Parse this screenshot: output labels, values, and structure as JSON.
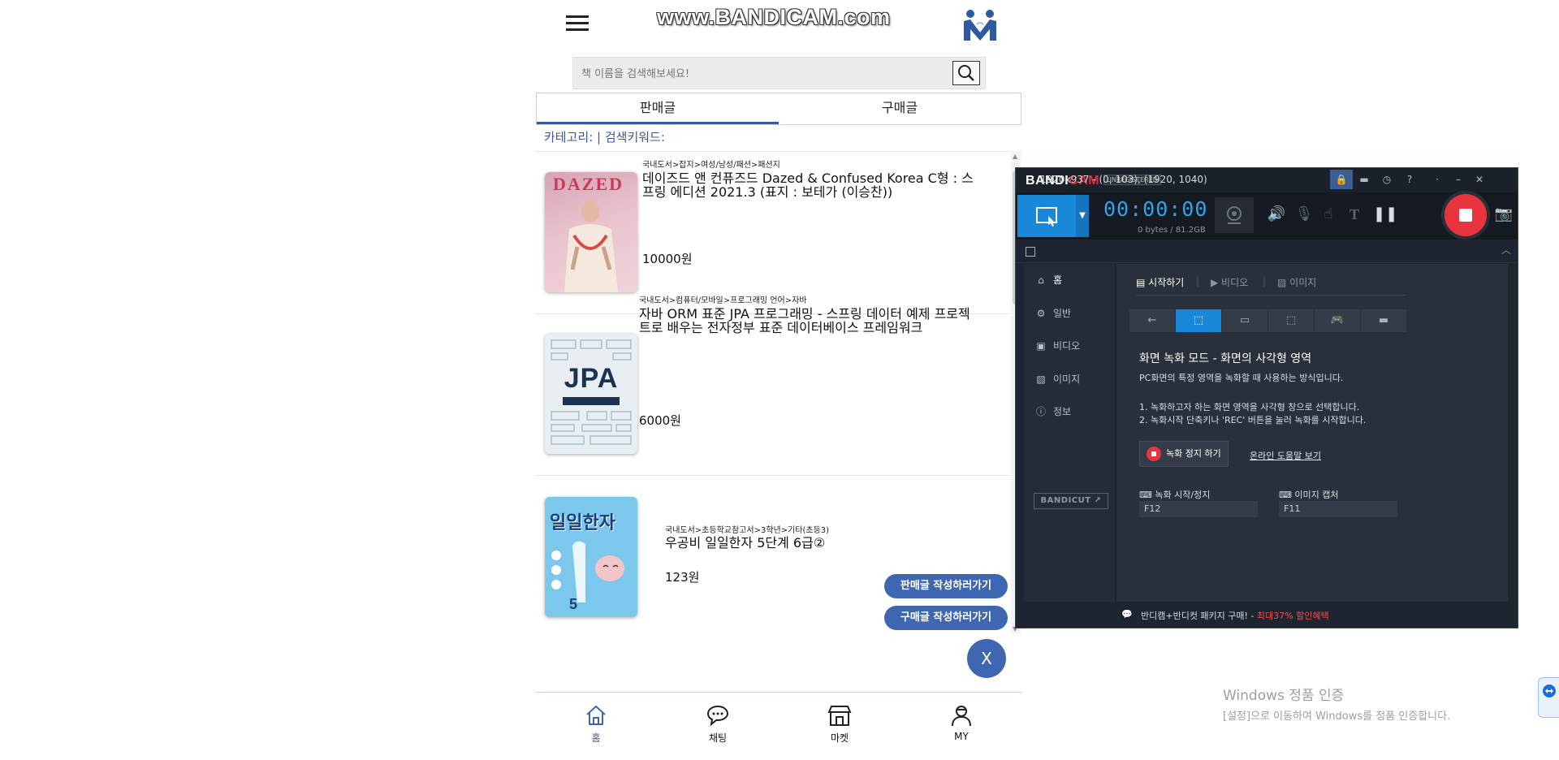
{
  "app": {
    "watermark": "www.BANDICAM.com",
    "search": {
      "placeholder": "책 이름을 검색해보세요!"
    },
    "tabs": [
      {
        "label": "판매글"
      },
      {
        "label": "구매글"
      }
    ],
    "category_line": "카테고리: | 검색키워드:",
    "books": [
      {
        "category_path": "국내도서>잡지>여성/남성/패션>패션지",
        "title": "데이즈드 앤 컨퓨즈드 Dazed & Confused Korea C형 : 스프링 에디션 2021.3 (표지 : 보테가 (이승찬))",
        "price": "10000원",
        "cover_text": "DAZED"
      },
      {
        "category_path": "국내도서>컴퓨터/모바일>프로그래밍 언어>자바",
        "title": "자바 ORM 표준 JPA 프로그래밍 - 스프링 데이터 예제 프로젝트로 배우는 전자정부 표준 데이터베이스 프레임워크",
        "price": "6000원",
        "cover_text": "JPA"
      },
      {
        "category_path": "국내도서>초등학교참고서>3학년>기타(초등3)",
        "title": "우공비 일일한자 5단계 6급②",
        "price": "123원",
        "cover_text": "일일한자"
      }
    ],
    "fab_buttons": [
      {
        "label": "판매글 작성하러가기"
      },
      {
        "label": "구매글 작성하러가기"
      }
    ],
    "close_label": "X",
    "bottom_nav": [
      {
        "label": "홈"
      },
      {
        "label": "채팅"
      },
      {
        "label": "마켓"
      },
      {
        "label": "MY"
      }
    ]
  },
  "bandicam": {
    "brand_main": "BANDI",
    "brand_accent": "CAM",
    "unregistered": "UNREGISTERED",
    "timer": "00:00:00",
    "bytes": "0 bytes / 81.2GB",
    "area": "1920x937 - (0, 103), (1920, 1040)",
    "sidebar": [
      {
        "label": "홈",
        "icon": "home-icon"
      },
      {
        "label": "일반",
        "icon": "gear-icon"
      },
      {
        "label": "비디오",
        "icon": "video-settings-icon"
      },
      {
        "label": "이미지",
        "icon": "image-settings-icon"
      },
      {
        "label": "정보",
        "icon": "info-icon"
      }
    ],
    "bandicut": "BANDICUT ↗",
    "subtabs": [
      {
        "label": "시작하기"
      },
      {
        "label": "비디오"
      },
      {
        "label": "이미지"
      }
    ],
    "heading": "화면 녹화 모드 - 화면의 사각형 영역",
    "desc": "PC화면의 특정 영역을 녹화할 때 사용하는 방식입니다.",
    "step1": "1. 녹화하고자 하는 화면 영역을 사각형 창으로 선택합니다.",
    "step2": "2. 녹화시작 단축키나 'REC' 버튼을 눌러 녹화를 시작합니다.",
    "stop_button": "녹화 정지 하기",
    "help_link": "온라인 도움말 보기",
    "hotkeys": [
      {
        "label": "녹화 시작/정지",
        "value": "F12"
      },
      {
        "label": "이미지 캡처",
        "value": "F11"
      }
    ],
    "footer_text": "반디캠+반디컷 패키지 구매! - ",
    "footer_promo": "최대37% 할인혜택"
  },
  "windows": {
    "activation_title": "Windows 정품 인증",
    "activation_sub": "[설정]으로 이동하여 Windows를 정품 인증합니다."
  },
  "colors": {
    "accent": "#3f67b1",
    "bandicam_blue": "#1a88d8",
    "bandicam_red": "#e8343e"
  }
}
